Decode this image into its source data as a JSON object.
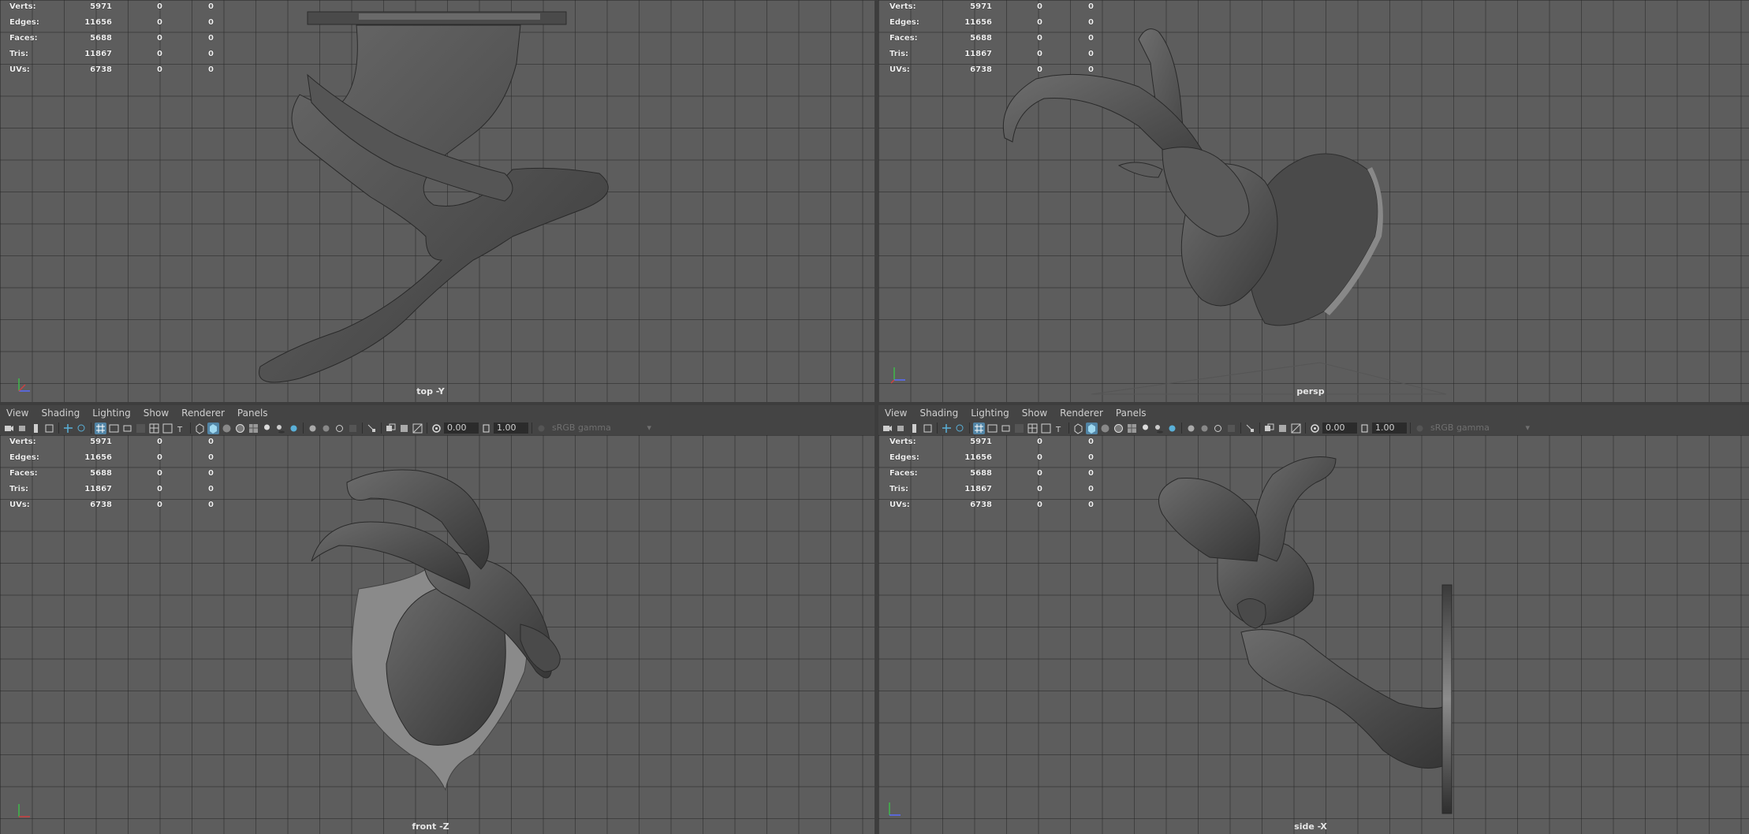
{
  "menu": [
    "View",
    "Shading",
    "Lighting",
    "Show",
    "Renderer",
    "Panels"
  ],
  "toolbar": {
    "exposure": "0.00",
    "gamma": "1.00",
    "color_space": "sRGB gamma"
  },
  "hud_labels": {
    "verts": "Verts:",
    "edges": "Edges:",
    "faces": "Faces:",
    "tris": "Tris:",
    "uvs": "UVs:"
  },
  "hud_values": {
    "verts": [
      "5971",
      "0",
      "0"
    ],
    "edges": [
      "11656",
      "0",
      "0"
    ],
    "faces": [
      "5688",
      "0",
      "0"
    ],
    "tris": [
      "11867",
      "0",
      "0"
    ],
    "uvs": [
      "6738",
      "0",
      "0"
    ]
  },
  "viewports": {
    "top": {
      "camera": "top -Y"
    },
    "persp": {
      "camera": "persp"
    },
    "front": {
      "camera": "front -Z"
    },
    "side": {
      "camera": "side -X"
    }
  },
  "colors": {
    "selected_icon": "#5285a6",
    "viewport_bg": "#5d5d5d",
    "panel_bg": "#444444"
  },
  "icons": [
    "camera-icon",
    "move-camera-icon",
    "bookmark-icon",
    "grid-icon",
    "wireframe-icon",
    "smooth-shade-icon",
    "textured-icon",
    "lights-icon",
    "shadows-icon",
    "isolate-icon",
    "xray-icon",
    "exposure-icon",
    "gamma-icon"
  ]
}
